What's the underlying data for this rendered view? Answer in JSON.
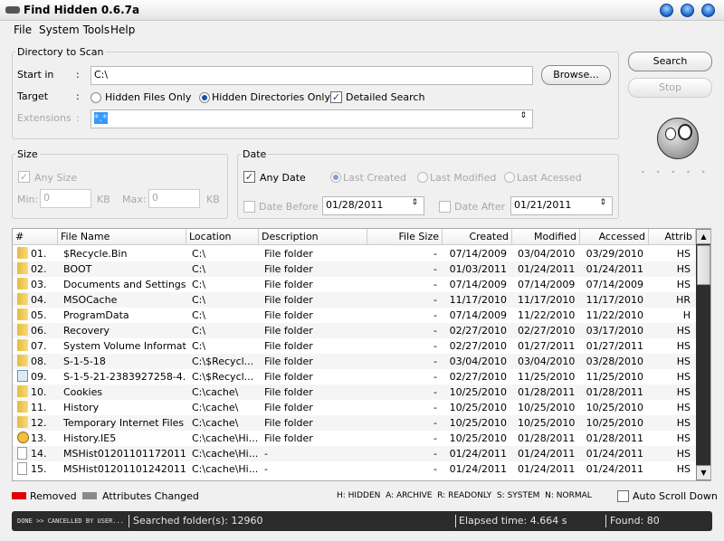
{
  "window": {
    "title": "Find Hidden 0.6.7a"
  },
  "menu": [
    {
      "label": "File"
    },
    {
      "label": "System Tools"
    },
    {
      "label": "Help"
    }
  ],
  "directory": {
    "group_title": "Directory to Scan",
    "start_label": "Start in",
    "start_value": "C:\\",
    "target_label": "Target",
    "radio_files": "Hidden Files Only",
    "radio_dirs": "Hidden Directories Only",
    "selected_target": "Hidden Directories Only",
    "detailed_label": "Detailed Search",
    "detailed_checked": true,
    "extensions_label": "Extensions",
    "extensions_value": "*.*",
    "colon": ":",
    "browse": "Browse..."
  },
  "actions": {
    "search": "Search",
    "stop": "Stop"
  },
  "size": {
    "group_title": "Size",
    "any_size": "Any Size",
    "min_label": "Min:",
    "min_value": "0",
    "max_label": "Max:",
    "max_value": "0",
    "unit": "KB"
  },
  "date": {
    "group_title": "Date",
    "any_date": "Any Date",
    "last_created": "Last Created",
    "last_modified": "Last Modified",
    "last_accessed": "Last Acessed",
    "date_before": "Date Before",
    "date_before_value": "01/28/2011",
    "date_after": "Date After",
    "date_after_value": "01/21/2011"
  },
  "table": {
    "columns": [
      "#",
      "File Name",
      "Location",
      "Description",
      "File Size",
      "Created",
      "Modified",
      "Accessed",
      "Attrib"
    ],
    "rows": [
      [
        "01.",
        "$Recycle.Bin",
        "C:\\",
        "File folder",
        "-",
        "07/14/2009",
        "03/04/2010",
        "03/29/2010",
        "HS",
        "folder"
      ],
      [
        "02.",
        "BOOT",
        "C:\\",
        "File folder",
        "-",
        "01/03/2011",
        "01/24/2011",
        "01/24/2011",
        "HS",
        "folder"
      ],
      [
        "03.",
        "Documents and Settings",
        "C:\\",
        "File folder",
        "-",
        "07/14/2009",
        "07/14/2009",
        "07/14/2009",
        "HS",
        "folder"
      ],
      [
        "04.",
        "MSOCache",
        "C:\\",
        "File folder",
        "-",
        "11/17/2010",
        "11/17/2010",
        "11/17/2010",
        "HR",
        "folder"
      ],
      [
        "05.",
        "ProgramData",
        "C:\\",
        "File folder",
        "-",
        "07/14/2009",
        "11/22/2010",
        "11/22/2010",
        "H",
        "folder"
      ],
      [
        "06.",
        "Recovery",
        "C:\\",
        "File folder",
        "-",
        "02/27/2010",
        "02/27/2010",
        "03/17/2010",
        "HS",
        "folder"
      ],
      [
        "07.",
        "System Volume Informat...",
        "C:\\",
        "File folder",
        "-",
        "02/27/2010",
        "01/27/2011",
        "01/27/2011",
        "HS",
        "folder"
      ],
      [
        "08.",
        "S-1-5-18",
        "C:\\$Recycl...",
        "File folder",
        "-",
        "03/04/2010",
        "03/04/2010",
        "03/28/2010",
        "HS",
        "folder"
      ],
      [
        "09.",
        "S-1-5-21-2383927258-4...",
        "C:\\$Recycl...",
        "File folder",
        "-",
        "02/27/2010",
        "11/25/2010",
        "11/25/2010",
        "HS",
        "recycle"
      ],
      [
        "10.",
        "Cookies",
        "C:\\cache\\",
        "File folder",
        "-",
        "10/25/2010",
        "01/28/2011",
        "01/28/2011",
        "HS",
        "folder"
      ],
      [
        "11.",
        "History",
        "C:\\cache\\",
        "File folder",
        "-",
        "10/25/2010",
        "10/25/2010",
        "10/25/2010",
        "HS",
        "folder"
      ],
      [
        "12.",
        "Temporary Internet Files",
        "C:\\cache\\",
        "File folder",
        "-",
        "10/25/2010",
        "10/25/2010",
        "10/25/2010",
        "HS",
        "folder"
      ],
      [
        "13.",
        "History.IE5",
        "C:\\cache\\Hi...",
        "File folder",
        "-",
        "10/25/2010",
        "01/28/2011",
        "01/28/2011",
        "HS",
        "history"
      ],
      [
        "14.",
        "MSHist01201101172011...",
        "C:\\cache\\Hi...",
        "-",
        "-",
        "01/24/2011",
        "01/24/2011",
        "01/24/2011",
        "HS",
        "file"
      ],
      [
        "15.",
        "MSHist01201101242011...",
        "C:\\cache\\Hi...",
        "-",
        "-",
        "01/24/2011",
        "01/24/2011",
        "01/24/2011",
        "HS",
        "file"
      ]
    ]
  },
  "legend": {
    "removed": "Removed",
    "removed_color": "#e00000",
    "changed": "Attributes Changed",
    "changed_color": "#8a8a8a",
    "key": "H: HIDDEN  A: ARCHIVE  R: READONLY  S: SYSTEM  N: NORMAL",
    "auto_scroll": "Auto Scroll Down"
  },
  "status": {
    "state": "DONE >> CANCELLED BY USER...",
    "searched": "Searched folder(s): 12960",
    "elapsed": "Elapsed time: 4.664 s",
    "found": "Found: 80"
  }
}
